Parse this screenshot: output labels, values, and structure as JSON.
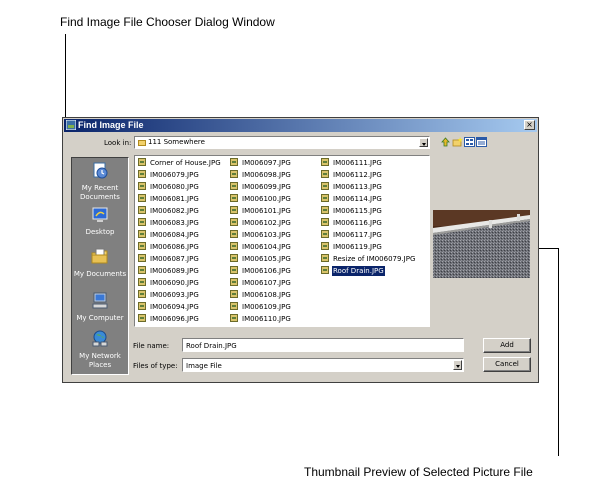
{
  "annotations": {
    "top_caption": "Find Image File Chooser Dialog Window",
    "bottom_caption": "Thumbnail Preview of Selected Picture File"
  },
  "dialog": {
    "title": "Find Image File",
    "close_glyph": "×",
    "look_in_label": "Look in:",
    "look_in_value": "111 Somewhere",
    "toolbar_icons": [
      "up-one-level-icon",
      "create-new-folder-icon",
      "list-view-icon",
      "details-view-icon"
    ],
    "places": [
      {
        "label": "My Recent Documents",
        "icon": "recent-documents-icon"
      },
      {
        "label": "Desktop",
        "icon": "desktop-icon"
      },
      {
        "label": "My Documents",
        "icon": "my-documents-icon"
      },
      {
        "label": "My Computer",
        "icon": "my-computer-icon"
      },
      {
        "label": "My Network Places",
        "icon": "network-places-icon"
      }
    ],
    "files": [
      "Corner of House.JPG",
      "IM006079.JPG",
      "IM006080.JPG",
      "IM006081.JPG",
      "IM006082.JPG",
      "IM006083.JPG",
      "IM006084.JPG",
      "IM006086.JPG",
      "IM006087.JPG",
      "IM006089.JPG",
      "IM006090.JPG",
      "IM006093.JPG",
      "IM006094.JPG",
      "IM006096.JPG",
      "IM006097.JPG",
      "IM006098.JPG",
      "IM006099.JPG",
      "IM006100.JPG",
      "IM006101.JPG",
      "IM006102.JPG",
      "IM006103.JPG",
      "IM006104.JPG",
      "IM006105.JPG",
      "IM006106.JPG",
      "IM006107.JPG",
      "IM006108.JPG",
      "IM006109.JPG",
      "IM006110.JPG",
      "IM006111.JPG",
      "IM006112.JPG",
      "IM006113.JPG",
      "IM006114.JPG",
      "IM006115.JPG",
      "IM006116.JPG",
      "IM006117.JPG",
      "IM006119.JPG",
      "Resize of IM006079.JPG",
      "Roof Drain.JPG"
    ],
    "selected_file": "Roof Drain.JPG",
    "file_name_label": "File name:",
    "file_name_value": "Roof Drain.JPG",
    "file_type_label": "Files of type:",
    "file_type_value": "Image File",
    "add_button": "Add",
    "cancel_button": "Cancel"
  },
  "colors": {
    "titlebar_start": "#0a246a",
    "titlebar_end": "#a6caf0",
    "dialog_face": "#d4d0c8",
    "places_bar": "#808080",
    "selection": "#0a246a"
  }
}
